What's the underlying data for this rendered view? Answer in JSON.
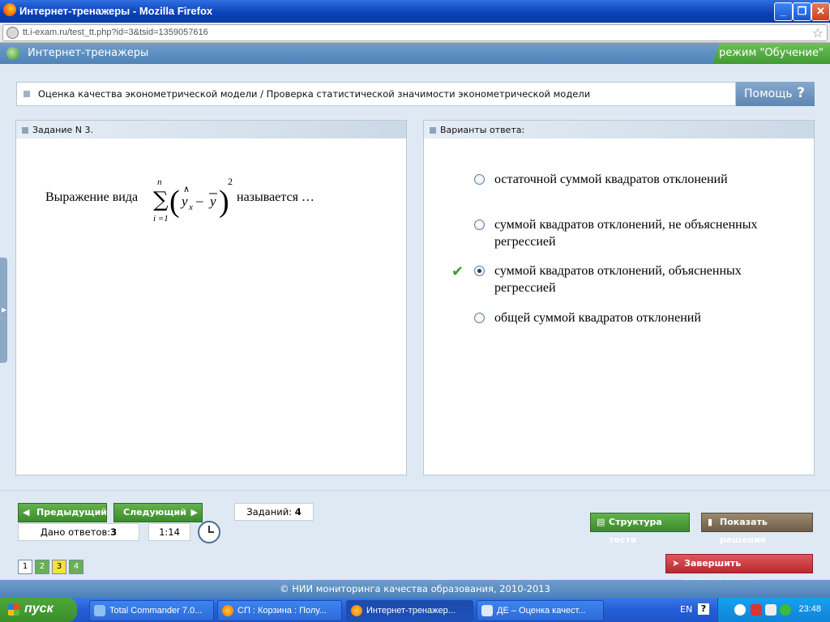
{
  "browser": {
    "title": "Интернет-тренажеры - Mozilla Firefox",
    "url": "tt.i-exam.ru/test_tt.php?id=3&tsid=1359057616",
    "buttons": {
      "minimize": "_",
      "maximize": "❐",
      "close": "✕"
    }
  },
  "app": {
    "name": "Интернет-тренажеры",
    "mode": "режим \"Обучение\""
  },
  "breadcrumb": "Оценка качества эконометрической модели / Проверка статистической значимости эконометрической модели",
  "help": {
    "label": "Помощь",
    "icon": "?"
  },
  "task": {
    "header": "Задание N 3.",
    "text_before": "Выражение вида",
    "text_after": "называется …",
    "formula": {
      "upper": "n",
      "lower": "i =1",
      "sigma": "∑",
      "left_paren": "(",
      "right_paren": ")",
      "y_hat": "y",
      "hat_sub": "x",
      "hat": "∧",
      "minus": "–",
      "y_bar": "y",
      "exponent": "2"
    }
  },
  "answers": {
    "header": "Варианты ответа:",
    "options": [
      {
        "text": "остаточной суммой квадратов отклонений",
        "selected": false,
        "correct": false
      },
      {
        "text": "суммой квадратов отклонений, не объясненных регрессией",
        "selected": false,
        "correct": false
      },
      {
        "text": "суммой квадратов отклонений, объясненных регрессией",
        "selected": true,
        "correct": true
      },
      {
        "text": "общей суммой квадратов отклонений",
        "selected": false,
        "correct": false
      }
    ],
    "check_mark": "✔"
  },
  "nav": {
    "prev": "Предыдущий",
    "next": "Следующий",
    "tasks_label": "Заданий:",
    "tasks_count": "4",
    "answered_label": "Дано ответов:",
    "answered_count": "3",
    "time": "1:14",
    "pages": [
      "1",
      "2",
      "3",
      "4"
    ]
  },
  "actions": {
    "structure": "Структура теста",
    "show_solution": "Показать решение",
    "finish": "Завершить тестирование"
  },
  "footer": "© НИИ мониторинга качества образования, 2010-2013",
  "taskbar": {
    "start": "пуск",
    "items": [
      "Total Commander 7.0...",
      "СП : Корзина : Полу...",
      "Интернет-тренажер...",
      "ДЕ – Оценка качест..."
    ],
    "lang": "EN",
    "help": "?",
    "time": "23:48"
  },
  "colors": {
    "accent_green": "#3c8a2c",
    "accent_blue": "#4e82b6",
    "solution_brown": "#7a6a55",
    "finish_red": "#c9353a"
  }
}
